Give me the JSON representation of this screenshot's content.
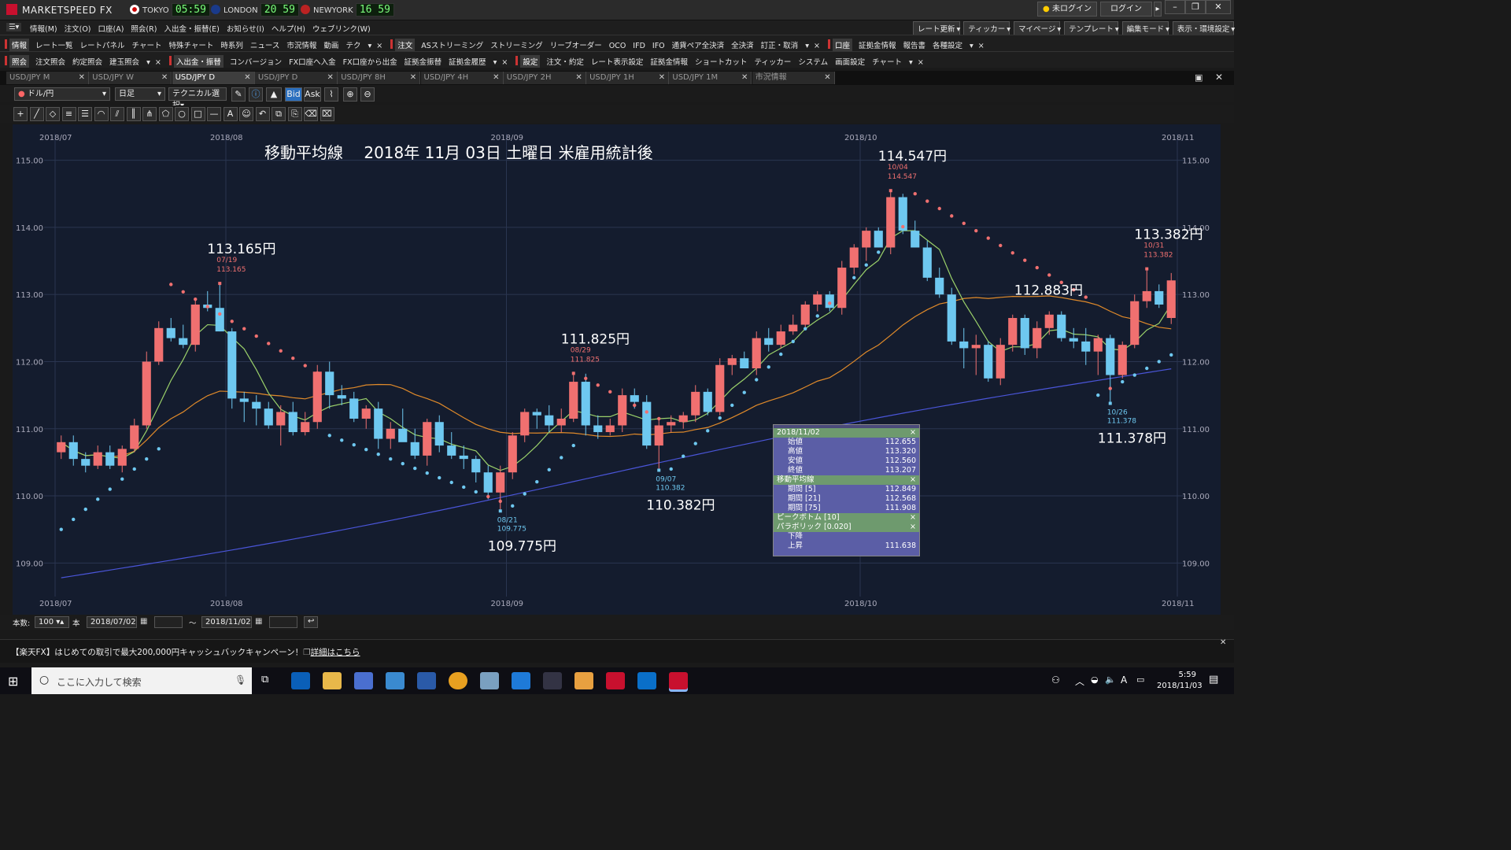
{
  "app": {
    "title": "MARKETSPEED FX",
    "brand_color": "#c8102e"
  },
  "clocks": [
    {
      "city": "TOKYO",
      "time": "05:59"
    },
    {
      "city": "LONDON",
      "time": "20 59"
    },
    {
      "city": "NEWYORK",
      "time": "16 59"
    }
  ],
  "login": {
    "status": "未ログイン",
    "button": "ログイン"
  },
  "menu": [
    "情報(M)",
    "注文(O)",
    "口座(A)",
    "照会(R)",
    "入出金・振替(E)",
    "お知らせ(I)",
    "ヘルプ(H)",
    "ウェブリンク(W)"
  ],
  "top_right_menus": [
    "レート更新",
    "ティッカー",
    "マイページ",
    "テンプレート",
    "編集モード",
    "表示・環境設定"
  ],
  "toolbar1": {
    "group1": "情報",
    "items1": [
      "レート一覧",
      "レートパネル",
      "チャート",
      "特殊チャート",
      "時系列",
      "ニュース",
      "市況情報",
      "動画",
      "テク"
    ],
    "group2": "注文",
    "items2": [
      "ASストリーミング",
      "ストリーミング",
      "リーブオーダー",
      "OCO",
      "IFD",
      "IFO",
      "通貨ペア全決済",
      "全決済",
      "訂正・取消"
    ],
    "group3": "口座",
    "items3": [
      "証拠金情報",
      "報告書",
      "各種設定"
    ]
  },
  "toolbar2": {
    "group1": "照会",
    "items1": [
      "注文照会",
      "約定照会",
      "建玉照会"
    ],
    "group2": "入出金・振替",
    "items2": [
      "コンバージョン",
      "FX口座へ入金",
      "FX口座から出金",
      "証拠金振替",
      "証拠金履歴"
    ],
    "group3": "設定",
    "items3": [
      "注文・約定",
      "レート表示設定",
      "証拠金情報",
      "ショートカット",
      "ティッカー",
      "システム",
      "画面設定",
      "チャート"
    ]
  },
  "tabs": [
    "USD/JPY M",
    "USD/JPY W",
    "USD/JPY D",
    "USD/JPY D",
    "USD/JPY 8H",
    "USD/JPY 4H",
    "USD/JPY 2H",
    "USD/JPY 1H",
    "USD/JPY 1M",
    "市況情報"
  ],
  "active_tab": 2,
  "controls": {
    "pair": "ドル/円",
    "period": "日足",
    "tech": "テクニカル選択",
    "bid": "Bid",
    "ask": "Ask"
  },
  "status": {
    "count_label": "本数:",
    "count": "100",
    "unit": "本",
    "from": "2018/07/02",
    "to": "2018/11/02",
    "tilde": "〜"
  },
  "banner": {
    "text": "【楽天FX】はじめての取引で最大200,000円キャッシュバックキャンペーン！",
    "link": "詳細はこちら"
  },
  "taskbar": {
    "search": "ここに入力して検索",
    "time": "5:59",
    "date": "2018/11/03",
    "ime": "A"
  },
  "infobox": {
    "date": "2018/11/02",
    "ohlc": [
      [
        "始値",
        "112.655"
      ],
      [
        "高値",
        "113.320"
      ],
      [
        "安値",
        "112.560"
      ],
      [
        "終値",
        "113.207"
      ]
    ],
    "ma_title": "移動平均線",
    "ma": [
      [
        "期間 [5]",
        "112.849"
      ],
      [
        "期間 [21]",
        "112.568"
      ],
      [
        "期間 [75]",
        "111.908"
      ]
    ],
    "pb_title": "ピークボトム [10]",
    "sar_title": "パラボリック [0.020]",
    "sar": [
      [
        "下降",
        ""
      ],
      [
        "上昇",
        "111.638"
      ]
    ]
  },
  "chart_data": {
    "type": "candlestick",
    "title": "移動平均線　 2018年 11月 03日 土曜日 米雇用統計後",
    "ylim": [
      108.5,
      115.3
    ],
    "yticks": [
      "115.00",
      "114.00",
      "113.00",
      "112.00",
      "111.00",
      "110.00",
      "109.00"
    ],
    "xticks": [
      "2018/07",
      "2018/08",
      "2018/09",
      "2018/10",
      "2018/11"
    ],
    "annotations": [
      {
        "text": "113.165円",
        "date": "07/19",
        "value": "113.165",
        "kind": "high"
      },
      {
        "text": "109.775円",
        "date": "08/21",
        "value": "109.775",
        "kind": "low"
      },
      {
        "text": "111.825円",
        "date": "08/29",
        "value": "111.825",
        "kind": "high"
      },
      {
        "text": "110.382円",
        "date": "09/07",
        "value": "110.382",
        "kind": "low"
      },
      {
        "text": "114.547円",
        "date": "10/04",
        "value": "114.547",
        "kind": "high"
      },
      {
        "text": "111.378円",
        "date": "10/26",
        "value": "111.378",
        "kind": "low"
      },
      {
        "text": "113.382円",
        "date": "10/31",
        "value": "113.382",
        "kind": "high"
      },
      {
        "text": "112.883円",
        "date": "",
        "value": "",
        "kind": "plain"
      }
    ],
    "candles": [
      [
        110.65,
        110.9,
        110.55,
        110.8
      ],
      [
        110.8,
        110.9,
        110.45,
        110.55
      ],
      [
        110.55,
        110.65,
        110.35,
        110.45
      ],
      [
        110.45,
        110.75,
        110.4,
        110.65
      ],
      [
        110.65,
        110.75,
        110.4,
        110.45
      ],
      [
        110.45,
        110.75,
        110.35,
        110.7
      ],
      [
        110.7,
        111.15,
        110.65,
        111.05
      ],
      [
        111.05,
        112.15,
        111.0,
        112.0
      ],
      [
        112.0,
        112.6,
        111.95,
        112.5
      ],
      [
        112.5,
        112.65,
        112.3,
        112.35
      ],
      [
        112.35,
        112.55,
        112.2,
        112.25
      ],
      [
        112.25,
        112.95,
        112.15,
        112.85
      ],
      [
        112.85,
        113.05,
        112.75,
        112.8
      ],
      [
        112.8,
        113.16,
        112.45,
        112.45
      ],
      [
        112.45,
        112.5,
        111.3,
        111.45
      ],
      [
        111.45,
        111.55,
        111.1,
        111.4
      ],
      [
        111.4,
        111.5,
        111.05,
        111.3
      ],
      [
        111.3,
        111.4,
        111.0,
        111.05
      ],
      [
        111.05,
        111.35,
        110.75,
        111.25
      ],
      [
        111.25,
        111.4,
        110.9,
        110.95
      ],
      [
        110.95,
        111.25,
        110.9,
        111.1
      ],
      [
        111.1,
        111.95,
        111.0,
        111.85
      ],
      [
        111.85,
        112.0,
        111.3,
        111.5
      ],
      [
        111.5,
        111.65,
        111.35,
        111.45
      ],
      [
        111.45,
        111.55,
        111.1,
        111.15
      ],
      [
        111.15,
        111.35,
        111.0,
        111.3
      ],
      [
        111.3,
        111.4,
        110.7,
        110.85
      ],
      [
        110.85,
        111.1,
        110.7,
        111.0
      ],
      [
        111.0,
        111.3,
        110.85,
        110.8
      ],
      [
        110.8,
        111.0,
        110.55,
        110.6
      ],
      [
        110.6,
        111.15,
        110.45,
        111.1
      ],
      [
        111.1,
        111.2,
        110.65,
        110.75
      ],
      [
        110.75,
        110.95,
        110.55,
        110.6
      ],
      [
        110.6,
        110.75,
        110.4,
        110.55
      ],
      [
        110.55,
        110.6,
        110.2,
        110.35
      ],
      [
        110.35,
        110.45,
        109.95,
        110.05
      ],
      [
        110.05,
        110.45,
        109.78,
        110.35
      ],
      [
        110.35,
        110.95,
        110.25,
        110.9
      ],
      [
        110.9,
        111.3,
        110.8,
        111.25
      ],
      [
        111.25,
        111.3,
        111.0,
        111.2
      ],
      [
        111.2,
        111.35,
        110.95,
        111.05
      ],
      [
        111.05,
        111.3,
        110.95,
        111.15
      ],
      [
        111.15,
        111.85,
        111.1,
        111.7
      ],
      [
        111.7,
        111.82,
        110.9,
        111.05
      ],
      [
        111.05,
        111.2,
        110.85,
        110.95
      ],
      [
        110.95,
        111.15,
        110.9,
        111.05
      ],
      [
        111.05,
        111.6,
        110.95,
        111.5
      ],
      [
        111.5,
        111.6,
        111.3,
        111.4
      ],
      [
        111.4,
        111.5,
        110.7,
        110.75
      ],
      [
        110.75,
        111.15,
        110.38,
        111.05
      ],
      [
        111.05,
        111.2,
        110.95,
        111.1
      ],
      [
        111.1,
        111.25,
        111.0,
        111.2
      ],
      [
        111.2,
        111.65,
        111.1,
        111.55
      ],
      [
        111.55,
        111.6,
        111.2,
        111.25
      ],
      [
        111.25,
        112.05,
        111.2,
        111.95
      ],
      [
        111.95,
        112.1,
        111.8,
        112.05
      ],
      [
        112.05,
        112.15,
        111.9,
        111.9
      ],
      [
        111.9,
        112.45,
        111.8,
        112.35
      ],
      [
        112.35,
        112.5,
        112.15,
        112.25
      ],
      [
        112.25,
        112.55,
        112.2,
        112.45
      ],
      [
        112.45,
        112.7,
        112.4,
        112.55
      ],
      [
        112.55,
        112.9,
        112.5,
        112.85
      ],
      [
        112.85,
        113.05,
        112.75,
        113.0
      ],
      [
        113.0,
        113.05,
        112.75,
        112.8
      ],
      [
        112.8,
        113.5,
        112.7,
        113.4
      ],
      [
        113.4,
        113.75,
        113.3,
        113.7
      ],
      [
        113.7,
        114.0,
        113.5,
        113.95
      ],
      [
        113.95,
        114.0,
        113.7,
        113.7
      ],
      [
        113.7,
        114.55,
        113.6,
        114.45
      ],
      [
        114.45,
        114.5,
        113.9,
        113.95
      ],
      [
        113.95,
        114.1,
        113.7,
        113.7
      ],
      [
        113.7,
        113.8,
        113.2,
        113.25
      ],
      [
        113.25,
        113.4,
        112.95,
        113.0
      ],
      [
        113.0,
        113.1,
        112.25,
        112.3
      ],
      [
        112.3,
        112.5,
        111.9,
        112.2
      ],
      [
        112.2,
        112.4,
        111.8,
        112.25
      ],
      [
        112.25,
        112.3,
        111.7,
        111.75
      ],
      [
        111.75,
        112.35,
        111.65,
        112.25
      ],
      [
        112.25,
        112.7,
        112.15,
        112.65
      ],
      [
        112.65,
        112.7,
        112.1,
        112.2
      ],
      [
        112.2,
        112.6,
        112.05,
        112.5
      ],
      [
        112.5,
        112.75,
        112.4,
        112.7
      ],
      [
        112.7,
        112.75,
        112.3,
        112.35
      ],
      [
        112.35,
        112.5,
        112.2,
        112.3
      ],
      [
        112.3,
        112.5,
        111.95,
        112.15
      ],
      [
        112.15,
        112.4,
        111.8,
        112.35
      ],
      [
        112.35,
        112.4,
        111.38,
        111.8
      ],
      [
        111.8,
        112.3,
        111.75,
        112.25
      ],
      [
        112.25,
        113.0,
        112.2,
        112.9
      ],
      [
        112.9,
        113.38,
        112.8,
        113.05
      ],
      [
        113.05,
        113.15,
        112.8,
        112.85
      ],
      [
        112.65,
        113.32,
        112.56,
        113.21
      ]
    ]
  }
}
